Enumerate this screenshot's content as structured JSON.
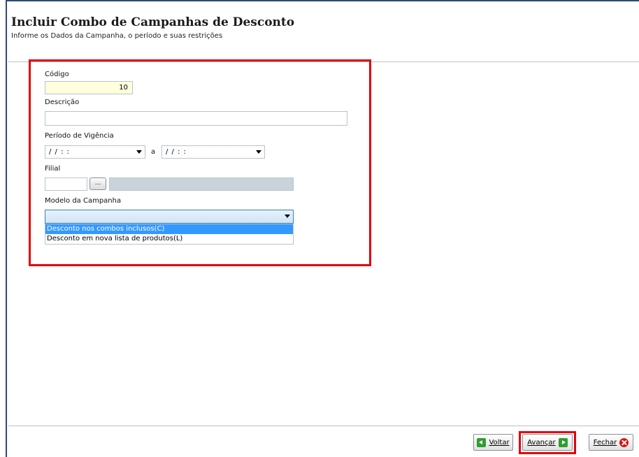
{
  "header": {
    "title": "Incluir Combo de Campanhas de Desconto",
    "subtitle": "Informe os Dados da Campanha, o período e suas restrições"
  },
  "form": {
    "codigo_label": "Código",
    "codigo_value": "10",
    "descricao_label": "Descrição",
    "descricao_value": "",
    "periodo_label": "Período de Vigência",
    "periodo_inicio": "/ /   : :",
    "periodo_separator": "a",
    "periodo_fim": "/ /   : :",
    "filial_label": "Filial",
    "filial_value": "",
    "browse_label": "...",
    "modelo_label": "Modelo da Campanha",
    "modelo_value": "",
    "modelo_options": [
      "Desconto nos combos inclusos(C)",
      "Desconto em nova lista de produtos(L)"
    ]
  },
  "footer": {
    "voltar_label": "Voltar",
    "avancar_label": "Avançar",
    "fechar_label": "Fechar"
  },
  "colors": {
    "highlight": "#e3000b",
    "frame": "#2c4a78",
    "selected_option": "#3399ff"
  }
}
